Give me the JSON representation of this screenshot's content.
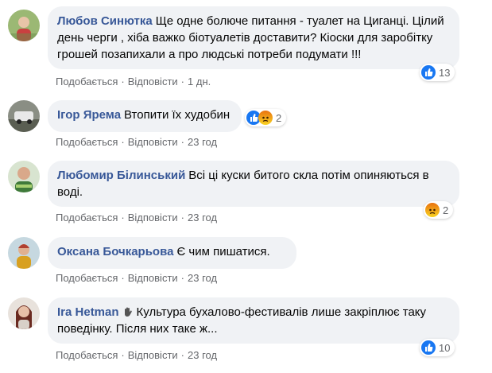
{
  "comments": [
    {
      "author": "Любов Синютка",
      "text": "Ще одне болюче питання - туалет на Циганці. Цілий день черги , хіба важко біотуалетів доставити? Кіоски для заробітку грошей позапихали а про людські потреби подумати !!!",
      "like_label": "Подобається",
      "reply_label": "Відповісти",
      "time": "1 дн.",
      "reaction_count": "13",
      "reactions": [
        "like-icon"
      ]
    },
    {
      "author": "Ігор Ярема",
      "text": "Втопити їх худобин",
      "like_label": "Подобається",
      "reply_label": "Відповісти",
      "time": "23 год",
      "reaction_count": "2",
      "reactions": [
        "like-icon",
        "angry-icon"
      ]
    },
    {
      "author": "Любомир Білинський",
      "text": "Всі ці куски битого скла потім опиняються в воді.",
      "like_label": "Подобається",
      "reply_label": "Відповісти",
      "time": "23 год",
      "reaction_count": "2",
      "reactions": [
        "angry-icon"
      ]
    },
    {
      "author": "Оксана Бочкарьова",
      "text": "Є чим пишатися.",
      "like_label": "Подобається",
      "reply_label": "Відповісти",
      "time": "23 год",
      "reaction_count": "",
      "reactions": []
    },
    {
      "author": "Ira Hetman",
      "text": "Культура бухалово-фестивалів лише закріплює таку поведінку. Після них таке ж...",
      "like_label": "Подобається",
      "reply_label": "Відповісти",
      "time": "23 год",
      "reaction_count": "10",
      "reactions": [
        "like-icon"
      ]
    }
  ],
  "colors": {
    "link": "#385898",
    "muted": "#65676b",
    "bubble": "#f0f2f5",
    "like": "#1877f2"
  }
}
